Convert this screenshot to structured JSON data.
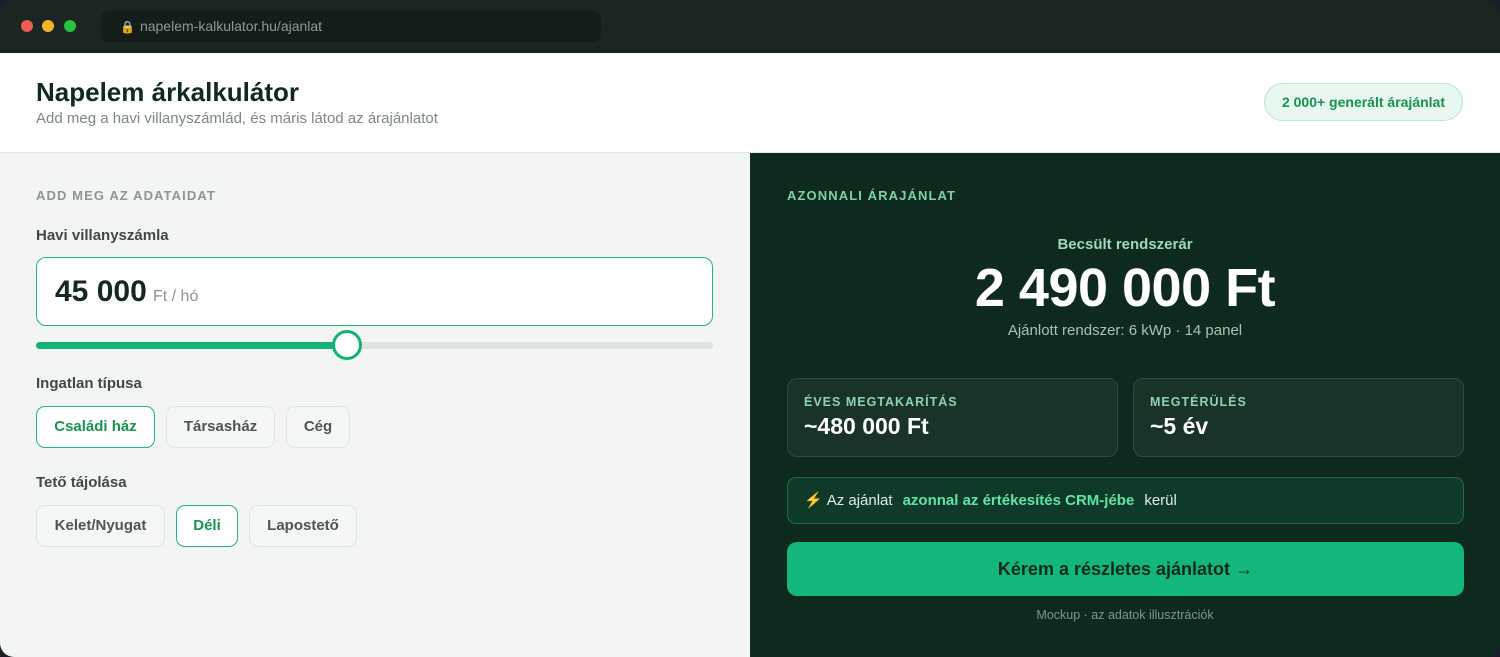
{
  "browser": {
    "url": "napelem-kalkulator.hu/ajanlat",
    "lock_icon": "🔒"
  },
  "header": {
    "title": "Napelem árkalkulátor",
    "subtitle": "Add meg a havi villanyszámlád, és máris látod az árajánlatot",
    "badge": "2 000+ generált árajánlat"
  },
  "form": {
    "section_title": "ADD MEG AZ ADATAIDAT",
    "bill_label": "Havi villanyszámla",
    "bill_value": "45 000",
    "bill_unit": "Ft / hó",
    "slider_fraction": 0.46,
    "property_label": "Ingatlan típusa",
    "property_options": [
      "Családi ház",
      "Társasház",
      "Cég"
    ],
    "property_selected": "Családi ház",
    "roof_label": "Tető tájolása",
    "roof_options": [
      "Kelet/Nyugat",
      "Déli",
      "Lapostető"
    ],
    "roof_selected": "Déli"
  },
  "quote": {
    "section_title": "AZONNALI ÁRAJÁNLAT",
    "estimate_label": "Becsült rendszerár",
    "price": "2 490 000 Ft",
    "recommended": "Ajánlott rendszer: 6 kWp · 14 panel",
    "savings_label": "ÉVES MEGTAKARÍTÁS",
    "savings_value": "~480 000 Ft",
    "payback_label": "MEGTÉRÜLÉS",
    "payback_value": "~5 év",
    "crm_icon": "⚡",
    "crm_prefix": "Az ajánlat",
    "crm_highlight": "azonnal az értékesítés CRM-jébe",
    "crm_suffix": "kerül",
    "cta_label": "Kérem a részletes ajánlatot",
    "cta_arrow": "→",
    "footnote": "Mockup · az adatok illusztrációk"
  },
  "colors": {
    "accent": "#13b473",
    "dark_panel": "#0e2a1f",
    "highlight": "#5fe3a6"
  }
}
